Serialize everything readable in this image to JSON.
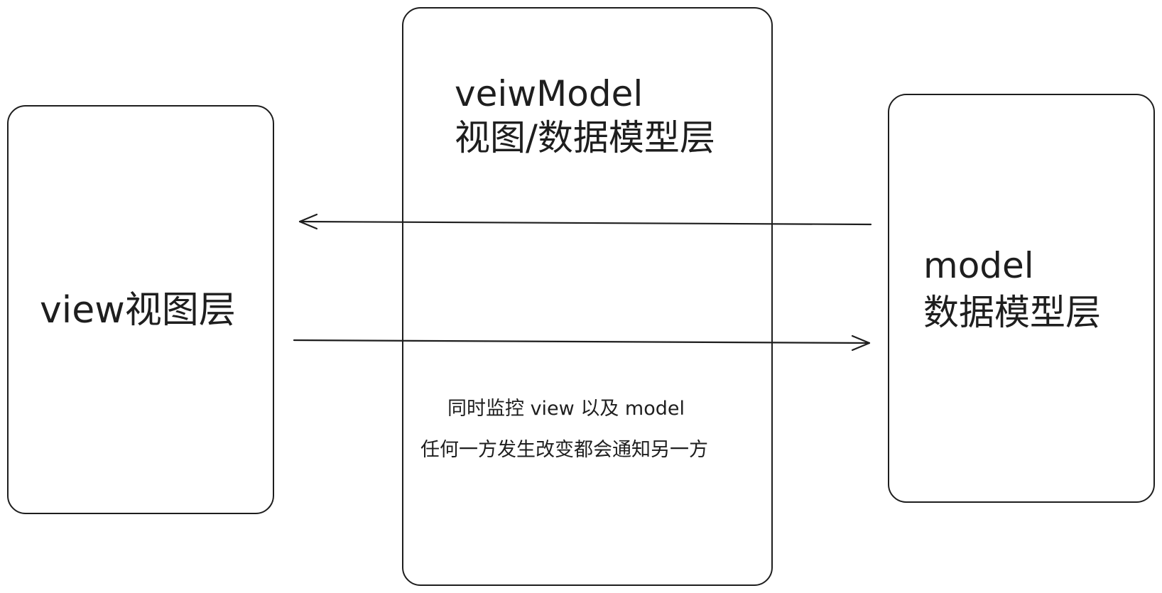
{
  "view": {
    "label": "view视图层"
  },
  "viewmodel": {
    "title_en": "veiwModel",
    "title_cn": "视图/数据模型层",
    "description_line1": "同时监控 view 以及 model",
    "description_line2": "任何一方发生改变都会通知另一方"
  },
  "model": {
    "title_en": "model",
    "title_cn": "数据模型层"
  },
  "colors": {
    "stroke": "#1e1e1e",
    "background": "#ffffff"
  }
}
